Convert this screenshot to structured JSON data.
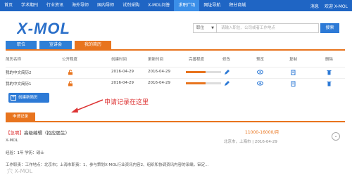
{
  "nav": {
    "items": [
      "首页",
      "学术期刊",
      "行业资讯",
      "海外导师",
      "国内导师",
      "试剂采购",
      "X-MOL问答",
      "求职广场",
      "网址导航",
      "积分商城"
    ],
    "active_index": 7,
    "right_items": [
      "消息",
      "欢迎 X-MOL"
    ]
  },
  "logo": {
    "text": "X-MOL"
  },
  "search": {
    "select": "职位",
    "placeholder": "请输入职位、公司或者工作地点",
    "button": "搜索"
  },
  "tabs": [
    "职位",
    "宣讲会",
    "我的简历"
  ],
  "tabs_active": 2,
  "table": {
    "headers": [
      "简历名称",
      "公开程度",
      "创建时间",
      "更新时间",
      "完善程度",
      "修改",
      "预览",
      "复制",
      "删除"
    ],
    "rows": [
      {
        "name": "我的中文简历2",
        "created": "2016-04-29",
        "updated": "2016-04-29",
        "progress": 0.55
      },
      {
        "name": "我的中文简历1",
        "created": "2016-04-29",
        "updated": "2016-04-29",
        "progress": 0.55
      }
    ]
  },
  "create_button": "创建新简历",
  "annotation": "申请记录在这里",
  "section_label": "申请记录",
  "job": {
    "urgent": "【急聘】",
    "title": "高级编辑（招应届生）",
    "salary": "11000-16000/月",
    "company": "X-MOL",
    "location": "北京市，上海市",
    "date": "2016-04-29",
    "requirements": "经验：1年   学历：硕士",
    "description": "工作职责：工作地点：北京市；上海市职责：1、参与策划X-MOL行业资讯内容2、组织和协调资讯内容的采编，审定..."
  },
  "watermark": "穴 X-MOL",
  "colors": {
    "nav": "#1f65c4",
    "accent": "#e8741e",
    "button": "#2d7ad6"
  }
}
